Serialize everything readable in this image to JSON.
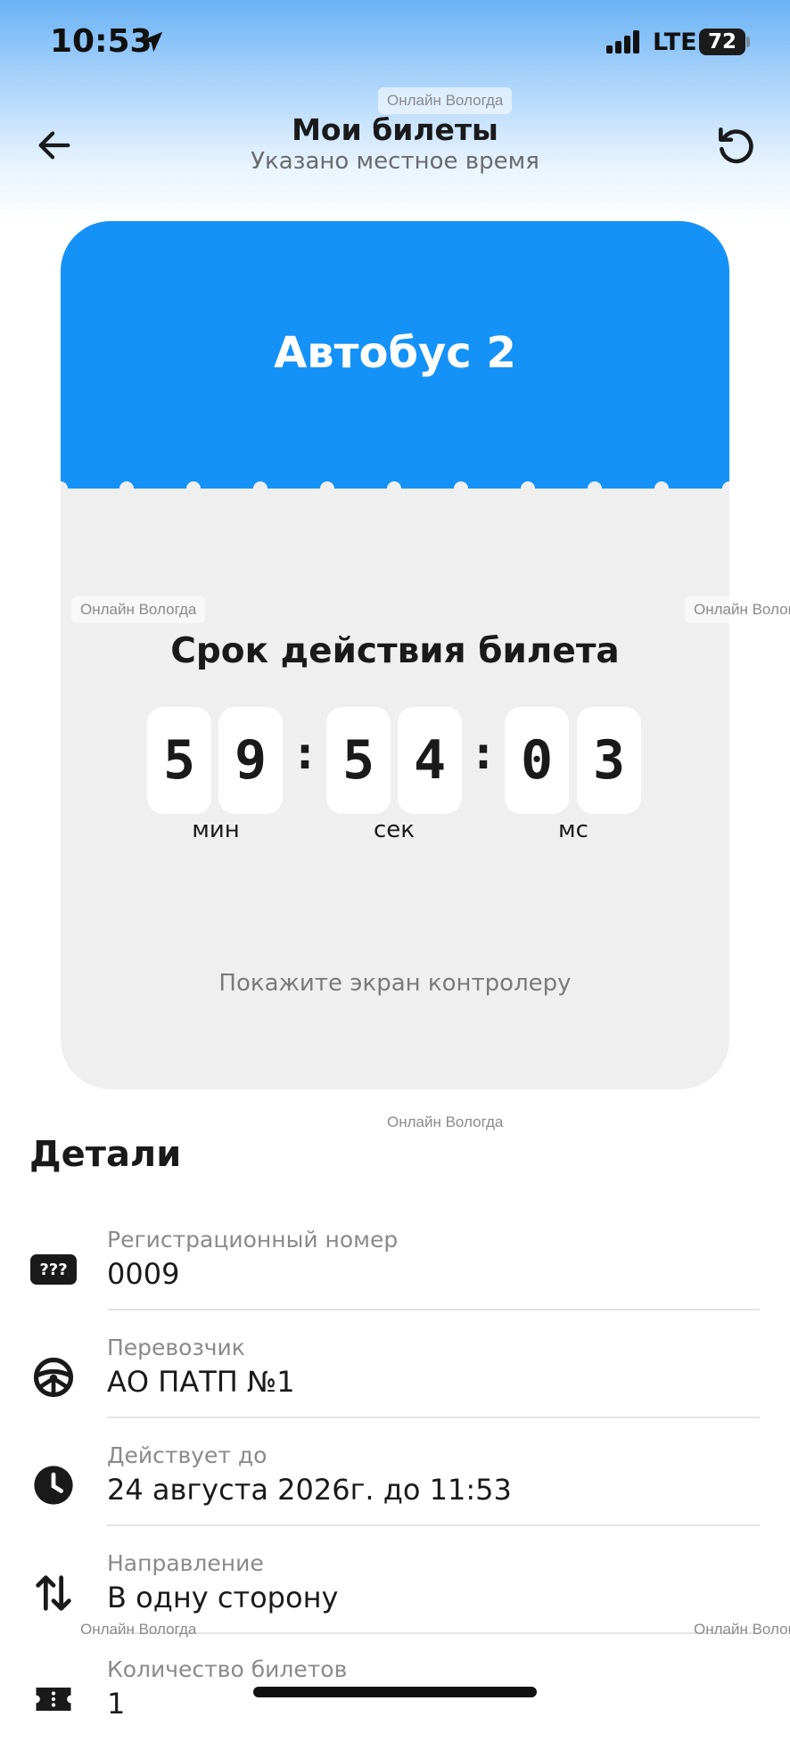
{
  "status_bar": {
    "time": "10:53",
    "network": "LTE",
    "battery": "72"
  },
  "watermarks": [
    "Онлайн Вологда",
    "Онлайн Вологда",
    "Онлайн Волог",
    "Онлайн Вологда",
    "Онлайн Вологда",
    "Онлайн Волог"
  ],
  "header": {
    "title": "Мои билеты",
    "subtitle": "Указано местное время"
  },
  "ticket": {
    "route": "Автобус 2",
    "validity_title": "Срок действия билета",
    "timer_digits": [
      "5",
      "9",
      "5",
      "4",
      "0",
      "3"
    ],
    "separator": ":",
    "units": [
      "мин",
      "сек",
      "мс"
    ],
    "instruction": "Покажите экран контролеру",
    "head_color": "#1592f8"
  },
  "details": {
    "heading": "Детали",
    "rows": [
      {
        "icon": "registration-number-icon",
        "icon_text": "???",
        "label": "Регистрационный номер",
        "value": "0009"
      },
      {
        "icon": "steering-wheel-icon",
        "label": "Перевозчик",
        "value": "АО ПАТП №1"
      },
      {
        "icon": "clock-icon",
        "label": "Действует до",
        "value": "24 августа 2026г. до 11:53"
      },
      {
        "icon": "direction-arrows-icon",
        "label": "Направление",
        "value": "В одну сторону"
      },
      {
        "icon": "ticket-icon",
        "label": "Количество билетов",
        "value": "1"
      }
    ]
  }
}
